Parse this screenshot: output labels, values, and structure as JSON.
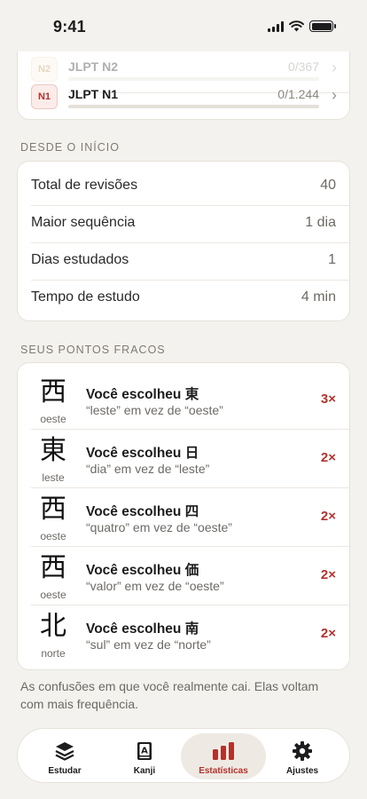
{
  "status_bar": {
    "time": "9:41"
  },
  "jlpt": {
    "levels": [
      {
        "badge": "N2",
        "name": "JLPT N2",
        "count": "0/367"
      },
      {
        "badge": "N1",
        "name": "JLPT N1",
        "count": "0/1.244"
      }
    ]
  },
  "since_start": {
    "section_label": "DESDE O INÍCIO",
    "rows": [
      {
        "label": "Total de revisões",
        "value": "40"
      },
      {
        "label": "Maior sequência",
        "value": "1 dia"
      },
      {
        "label": "Dias estudados",
        "value": "1"
      },
      {
        "label": "Tempo de estudo",
        "value": "4 min"
      }
    ]
  },
  "weak_points": {
    "section_label": "SEUS PONTOS FRACOS",
    "items": [
      {
        "kanji": "西",
        "reading": "oeste",
        "title": "Você escolheu 東",
        "subtitle": "“leste” em vez de “oeste”",
        "count": "3×"
      },
      {
        "kanji": "東",
        "reading": "leste",
        "title": "Você escolheu 日",
        "subtitle": "“dia” em vez de “leste”",
        "count": "2×"
      },
      {
        "kanji": "西",
        "reading": "oeste",
        "title": "Você escolheu 四",
        "subtitle": "“quatro” em vez de “oeste”",
        "count": "2×"
      },
      {
        "kanji": "西",
        "reading": "oeste",
        "title": "Você escolheu 価",
        "subtitle": "“valor” em vez de “oeste”",
        "count": "2×"
      },
      {
        "kanji": "北",
        "reading": "norte",
        "title": "Você escolheu 南",
        "subtitle": "“sul” em vez de “norte”",
        "count": "2×"
      }
    ],
    "footnote": "As confusões em que você realmente cai. Elas voltam com mais frequência."
  },
  "tab_bar": {
    "tabs": [
      {
        "label": "Estudar",
        "icon": "layers-icon"
      },
      {
        "label": "Kanji",
        "icon": "book-icon"
      },
      {
        "label": "Estatísticas",
        "icon": "bar-chart-icon",
        "active": true
      },
      {
        "label": "Ajustes",
        "icon": "gear-icon"
      }
    ]
  },
  "colors": {
    "accent": "#b3322c",
    "background": "#f4f2ee"
  }
}
